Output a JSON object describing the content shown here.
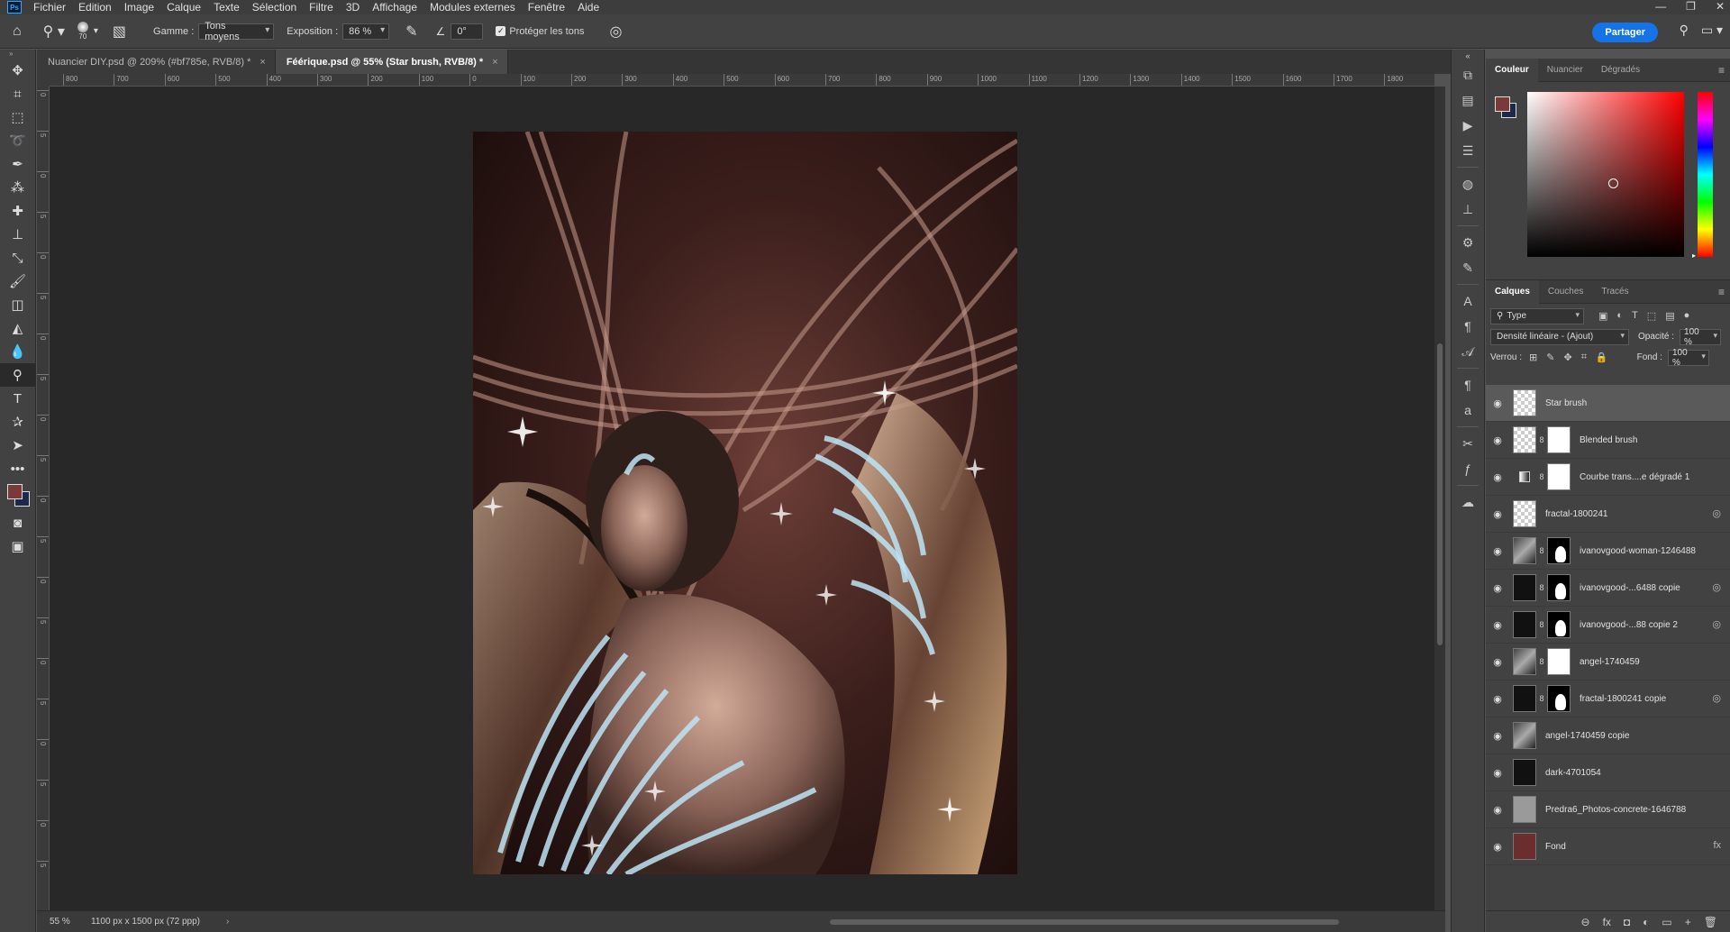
{
  "menubar": {
    "logo": "Ps",
    "items": [
      "Fichier",
      "Edition",
      "Image",
      "Calque",
      "Texte",
      "Sélection",
      "Filtre",
      "3D",
      "Affichage",
      "Modules externes",
      "Fenêtre",
      "Aide"
    ],
    "window_controls": [
      "—",
      "❐",
      "✕"
    ]
  },
  "options": {
    "brush_size": "70",
    "range_label": "Gamme :",
    "range_value": "Tons moyens",
    "exposure_label": "Exposition :",
    "exposure_value": "86 %",
    "angle_value": "0°",
    "protect_label": "Protéger les tons",
    "protect_checked": "✓",
    "share_label": "Partager"
  },
  "tabs": [
    {
      "label": "Nuancier DIY.psd @ 209% (#bf785e, RVB/8) *",
      "close": "×"
    },
    {
      "label": "Féérique.psd @ 55% (Star brush, RVB/8) *",
      "close": "×"
    }
  ],
  "rulers": {
    "top": [
      "800",
      "700",
      "600",
      "500",
      "400",
      "300",
      "200",
      "100",
      "0",
      "100",
      "200",
      "300",
      "400",
      "500",
      "600",
      "700",
      "800",
      "900",
      "1000",
      "1100",
      "1200",
      "1300",
      "1400",
      "1500",
      "1600",
      "1700",
      "1800",
      "1900"
    ],
    "left": [
      "0",
      "5",
      "0",
      "5",
      "0",
      "5",
      "0",
      "5",
      "0",
      "5",
      "0",
      "5",
      "0",
      "5",
      "0",
      "5",
      "0",
      "5",
      "0",
      "5"
    ]
  },
  "status": {
    "zoom": "55 %",
    "dimensions": "1100 px x 1500 px (72 ppp)",
    "arrow": "›"
  },
  "color_panel": {
    "tabs": [
      "Couleur",
      "Nuancier",
      "Dégradés"
    ],
    "foreground": "#7b3a3a",
    "background": "#1a2a4a"
  },
  "layers_panel": {
    "tabs": [
      "Calques",
      "Couches",
      "Tracés"
    ],
    "filter_label": "Type",
    "blend_mode": "Densité linéaire - (Ajout)",
    "opacity_label": "Opacité :",
    "opacity_value": "100 %",
    "lock_label": "Verrou :",
    "fill_label": "Fond :",
    "fill_value": "100 %",
    "layers": [
      {
        "name": "Star brush",
        "selected": true,
        "thumb": "trans",
        "mask": "",
        "badge": ""
      },
      {
        "name": "Blended brush",
        "selected": false,
        "thumb": "trans",
        "mask": "white",
        "badge": ""
      },
      {
        "name": "Courbe trans....e dégradé 1",
        "selected": false,
        "thumb": "adj",
        "mask": "white",
        "badge": ""
      },
      {
        "name": "fractal-1800241",
        "selected": false,
        "thumb": "trans",
        "mask": "",
        "badge": "◎"
      },
      {
        "name": "ivanovgood-woman-1246488",
        "selected": false,
        "thumb": "mixed",
        "mask": "black",
        "badge": ""
      },
      {
        "name": "ivanovgood-...6488 copie",
        "selected": false,
        "thumb": "dark",
        "mask": "black",
        "badge": "◎"
      },
      {
        "name": "ivanovgood-...88 copie 2",
        "selected": false,
        "thumb": "dark",
        "mask": "black",
        "badge": "◎"
      },
      {
        "name": "angel-1740459",
        "selected": false,
        "thumb": "mixed",
        "mask": "white",
        "badge": ""
      },
      {
        "name": "fractal-1800241 copie",
        "selected": false,
        "thumb": "dark",
        "mask": "black",
        "badge": "◎"
      },
      {
        "name": "angel-1740459 copie",
        "selected": false,
        "thumb": "mixed",
        "mask": "",
        "badge": ""
      },
      {
        "name": "dark-4701054",
        "selected": false,
        "thumb": "dark",
        "mask": "",
        "badge": ""
      },
      {
        "name": "Predra6_Photos-concrete-1646788",
        "selected": false,
        "thumb": "concrete",
        "mask": "",
        "badge": ""
      },
      {
        "name": "Fond",
        "selected": false,
        "thumb": "fond",
        "mask": "",
        "badge": "fx"
      }
    ],
    "bottom_icons": [
      "⊖",
      "fx",
      "◘",
      "◐",
      "▭",
      "+",
      "🗑"
    ]
  }
}
